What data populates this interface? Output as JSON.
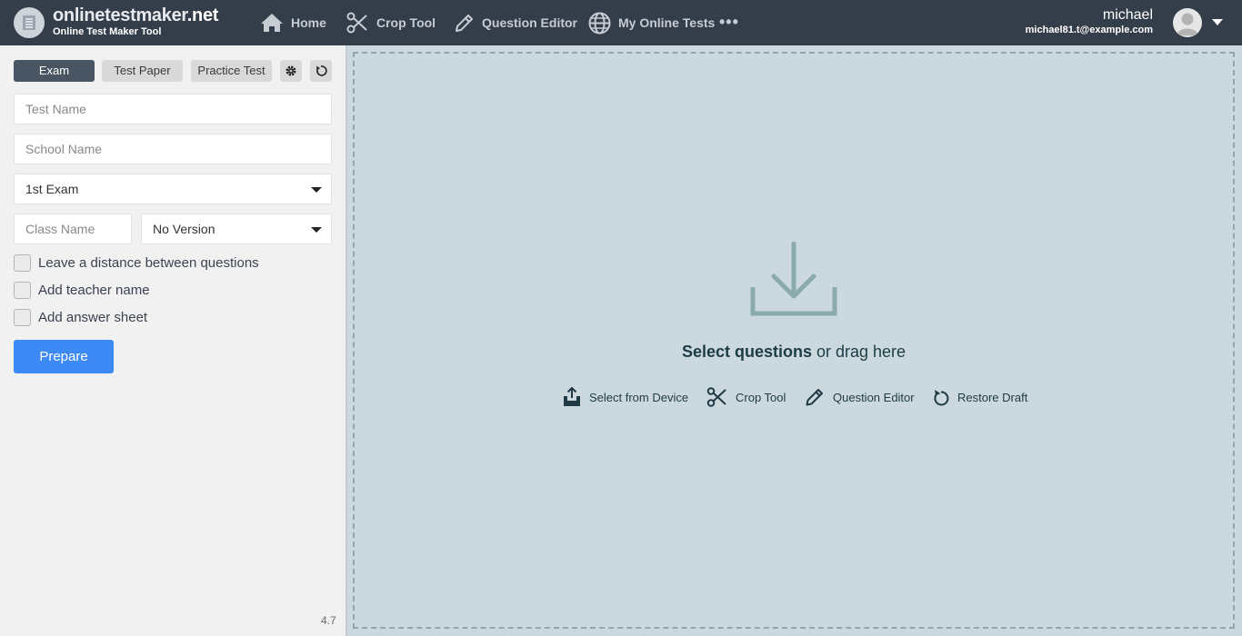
{
  "header": {
    "logo_main_a": "onlinetestmaker",
    "logo_main_b": ".net",
    "logo_sub": "Online Test Maker Tool",
    "nav": [
      {
        "label": "Home",
        "icon": "home-icon"
      },
      {
        "label": "Crop Tool",
        "icon": "scissors-icon"
      },
      {
        "label": "Question Editor",
        "icon": "pencil-icon"
      },
      {
        "label": "My Online Tests",
        "icon": "globe-icon"
      }
    ],
    "more": "•••",
    "user": {
      "name": "michael",
      "email": "michael81.t@example.com"
    }
  },
  "sidebar": {
    "modes": [
      {
        "label": "Exam",
        "active": true
      },
      {
        "label": "Test Paper",
        "active": false
      },
      {
        "label": "Practice Test",
        "active": false
      }
    ],
    "test_name_placeholder": "Test Name",
    "school_name_placeholder": "School Name",
    "exam_select_value": "1st Exam",
    "class_name_placeholder": "Class Name",
    "version_select_value": "No Version",
    "checkboxes": [
      {
        "label": "Leave a distance between questions",
        "checked": false
      },
      {
        "label": "Add teacher name",
        "checked": false
      },
      {
        "label": "Add answer sheet",
        "checked": false
      }
    ],
    "prepare_label": "Prepare",
    "version_number": "4.7"
  },
  "dropzone": {
    "title_bold": "Select questions",
    "title_rest": " or drag here",
    "actions": [
      {
        "label": "Select from Device",
        "icon": "upload-tray-icon"
      },
      {
        "label": "Crop Tool",
        "icon": "scissors-icon"
      },
      {
        "label": "Question Editor",
        "icon": "pencil-icon"
      },
      {
        "label": "Restore Draft",
        "icon": "restore-icon"
      }
    ]
  },
  "colors": {
    "topbar": "#343e4b",
    "accent": "#3d8af7",
    "dropzone": "#cbd9de"
  }
}
